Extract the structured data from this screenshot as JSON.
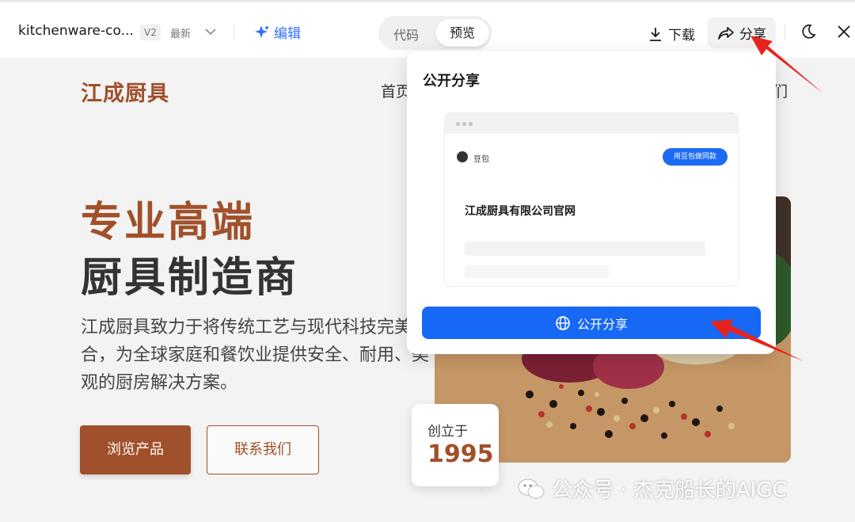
{
  "topbar": {
    "title": "kitchenware-co...",
    "version": "V2",
    "latest": "最新",
    "edit_label": "编辑",
    "tab_code": "代码",
    "tab_preview": "预览",
    "download_label": "下载",
    "share_label": "分享"
  },
  "site": {
    "logo": "江成厨具",
    "nav_home": "首页",
    "nav_contact_suffix": "们",
    "hero_line1": "专业高端",
    "hero_line2": "厨具制造商",
    "hero_desc": "江成厨具致力于将传统工艺与现代科技完美融合，为全球家庭和餐饮业提供安全、耐用、美观的厨房解决方案。",
    "btn_browse": "浏览产品",
    "btn_contact": "联系我们",
    "badge_label": "创立于",
    "badge_year": "1995"
  },
  "share_popup": {
    "title": "公开分享",
    "preview_user": "豆包",
    "preview_button": "用豆包做同款",
    "preview_heading": "江成厨具有限公司官网",
    "share_button": "公开分享"
  },
  "watermark": "公众号 · 杰克船长的AIGC",
  "colors": {
    "brand": "#a0502a",
    "accent": "#1668f5",
    "annotation_arrow": "#e8231e"
  }
}
